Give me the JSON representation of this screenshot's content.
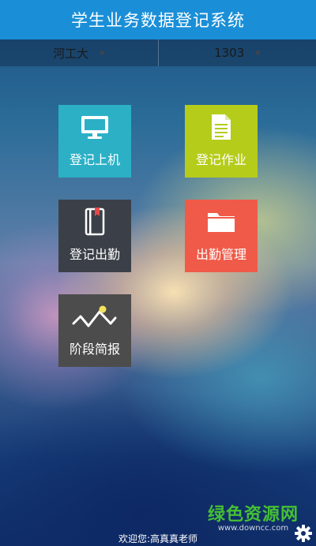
{
  "header": {
    "title": "学生业务数据登记系统"
  },
  "selectors": [
    {
      "value": "河工大"
    },
    {
      "value": "1303"
    }
  ],
  "tiles": [
    {
      "label": "登记上机",
      "icon": "monitor-icon",
      "color": "#2bb0c6"
    },
    {
      "label": "登记作业",
      "icon": "document-icon",
      "color": "#b6cc1b"
    },
    {
      "label": "登记出勤",
      "icon": "notebook-icon",
      "color": "#3b4048"
    },
    {
      "label": "出勤管理",
      "icon": "folder-icon",
      "color": "#f05a48"
    },
    {
      "label": "阶段简报",
      "icon": "trend-line-icon",
      "color": "#4c4c4c"
    }
  ],
  "footer": {
    "welcome": "欢迎您:高真真老师"
  },
  "watermark": {
    "main": "绿色资源网",
    "sub": "www.downcc.com"
  }
}
